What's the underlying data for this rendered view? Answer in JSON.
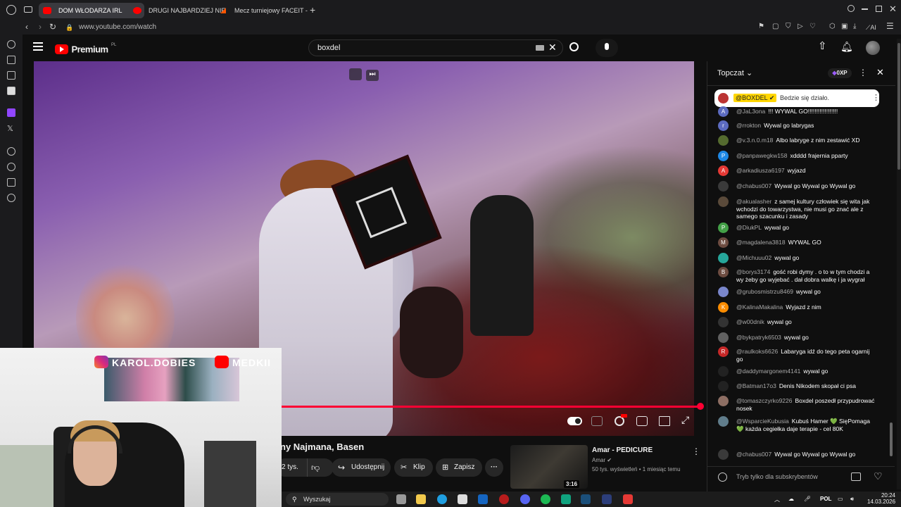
{
  "tabs": [
    {
      "title": "DOM WŁODARZA IRL"
    },
    {
      "title": "DRUGI NAJBARDZIEJ NIE"
    },
    {
      "title": "Mecz turniejowy FACEIT -"
    }
  ],
  "address": {
    "url": "www.youtube.com/watch"
  },
  "toolbar": {
    "ai_label": "AI"
  },
  "youtube": {
    "logo_text": "Premium",
    "logo_region": "PL",
    "search_value": "boxdel"
  },
  "webcam": {
    "instagram_handle": "KAROL.DOBIES",
    "youtube_handle": "MEDKII"
  },
  "video": {
    "title_fragment": "ny Najmana, Basen",
    "likes": "2 tys.",
    "share_label": "Udostępnij",
    "clip_label": "Klip",
    "save_label": "Zapisz",
    "progress_fraction": 1.0
  },
  "recommended": {
    "title": "Amar - PEDICURE",
    "channel": "Amar",
    "meta": "50 tys. wyświetleń • 1 miesiąc temu",
    "duration": "3:16"
  },
  "chat": {
    "header_title": "Topczat",
    "points": "0XP",
    "pinned_author": "@BOXDEL",
    "pinned_text": "Bedzie się działo.",
    "input_placeholder": "Tryb tylko dla subskrybentów",
    "messages": [
      {
        "initial": "A",
        "color": "#5c6bc0",
        "author": "@JaL3ona",
        "text": "!!! WYWAL GO!!!!!!!!!!!!!!!!!!"
      },
      {
        "initial": "r",
        "color": "#5c6bc0",
        "author": "@rrokton",
        "text": "Wywal go labrygas"
      },
      {
        "initial": "",
        "color": "#556b2f",
        "author": "@v.3.n.0.m18",
        "text": "Albo labryge z nim zestawić XD"
      },
      {
        "initial": "P",
        "color": "#1e88e5",
        "author": "@panpawegkw158",
        "text": "xdddd frajernia pparty"
      },
      {
        "initial": "A",
        "color": "#e53935",
        "author": "@arkadiusza6197",
        "text": "wyjazd"
      },
      {
        "initial": "",
        "color": "#3a3a3a",
        "author": "@chabus007",
        "text": "Wywal go Wywal go Wywal go"
      },
      {
        "initial": "",
        "color": "#5a4a3a",
        "author": "@akualasher",
        "text": "z samej kultury człowiek się wita jak wchodzi do towarzystwa, nie musi go znać ale z samego szacunku i zasady"
      },
      {
        "initial": "P",
        "color": "#43a047",
        "author": "@DiukPL",
        "text": "wywal go"
      },
      {
        "initial": "M",
        "color": "#6d4c41",
        "author": "@magdalena3818",
        "text": "WYWAL GO"
      },
      {
        "initial": "",
        "color": "#26a69a",
        "author": "@Michuuu02",
        "text": "wywal go"
      },
      {
        "initial": "B",
        "color": "#6d4c41",
        "author": "@borys3174",
        "text": "gość robi dymy . o to w tym chodzi a wy żeby go wyjebać . dał dobra walkę i ja wygrał"
      },
      {
        "initial": "",
        "color": "#7986cb",
        "author": "@grubosmistrzu8469",
        "text": "wywal go"
      },
      {
        "initial": "K",
        "color": "#fb8c00",
        "author": "@KalinaMakalina",
        "text": "Wyjazd z nim"
      },
      {
        "initial": "",
        "color": "#333333",
        "author": "@w00dnik",
        "text": "wywal go"
      },
      {
        "initial": "",
        "color": "#616161",
        "author": "@bykpatryk6503",
        "text": "wywal go"
      },
      {
        "initial": "R",
        "color": "#c62828",
        "author": "@raulkoks6626",
        "text": "Labaryga idź do tego peta ogarnij go"
      },
      {
        "initial": "",
        "color": "#222222",
        "author": "@daddymargonem4141",
        "text": "wywal go"
      },
      {
        "initial": "",
        "color": "#222222",
        "author": "@Batman17o3",
        "text": "Denis Nikodem skopał ci psa"
      },
      {
        "initial": "",
        "color": "#8d6e63",
        "author": "@tomaszczyrko9226",
        "text": "Boxdel poszedł przypudrować nosek"
      },
      {
        "initial": "",
        "color": "#607d8b",
        "author": "@WsparcieKubusia",
        "text": "Kubuś Hamer 💚 SięPomaga 💚 każda cegiełka daje terapie - cel 80K"
      },
      {
        "initial": "",
        "color": "#3a3a3a",
        "author": "@chabus007",
        "text": "Wywal go Wywal go Wywal go"
      }
    ]
  },
  "taskbar": {
    "search_placeholder": "Wyszukaj",
    "lang": "POL",
    "time": "20:24",
    "date": "14.03.2026"
  }
}
